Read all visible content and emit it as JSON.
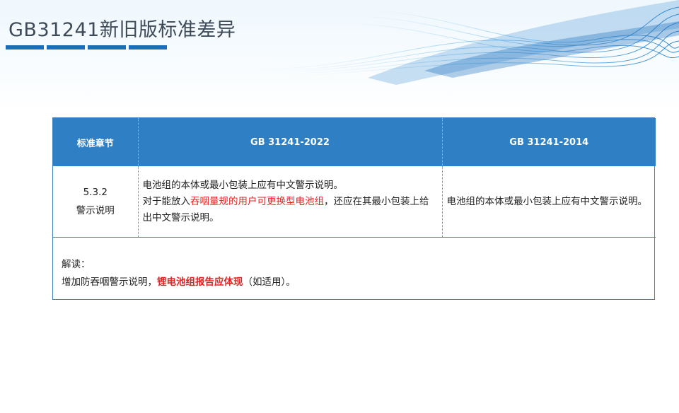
{
  "page": {
    "title": "GB31241新旧版标准差异"
  },
  "table": {
    "headers": [
      "标准章节",
      "GB 31241-2022",
      "GB 31241-2014"
    ],
    "row": {
      "chapter_number": "5.3.2",
      "chapter_name": "警示说明",
      "new_line1": "电池组的本体或最小包装上应有中文警示说明。",
      "new_line2_prefix": "对于能放入",
      "new_line2_highlight": "吞咽量规的用户可更换型电池组",
      "new_line2_suffix": "，还应在其最小包装上给出中文警示说明。",
      "old_text": "电池组的本体或最小包装上应有中文警示说明。"
    },
    "note": {
      "label": "解读：",
      "text_prefix": "增加防吞咽警示说明，",
      "text_highlight": "锂电池组报告应体现",
      "text_suffix": "（如适用）。"
    }
  },
  "colors": {
    "header_bg": "#2f7fc5",
    "border": "#3f82c4",
    "highlight": "#e02424",
    "title_bar": "#1e6cb4"
  }
}
